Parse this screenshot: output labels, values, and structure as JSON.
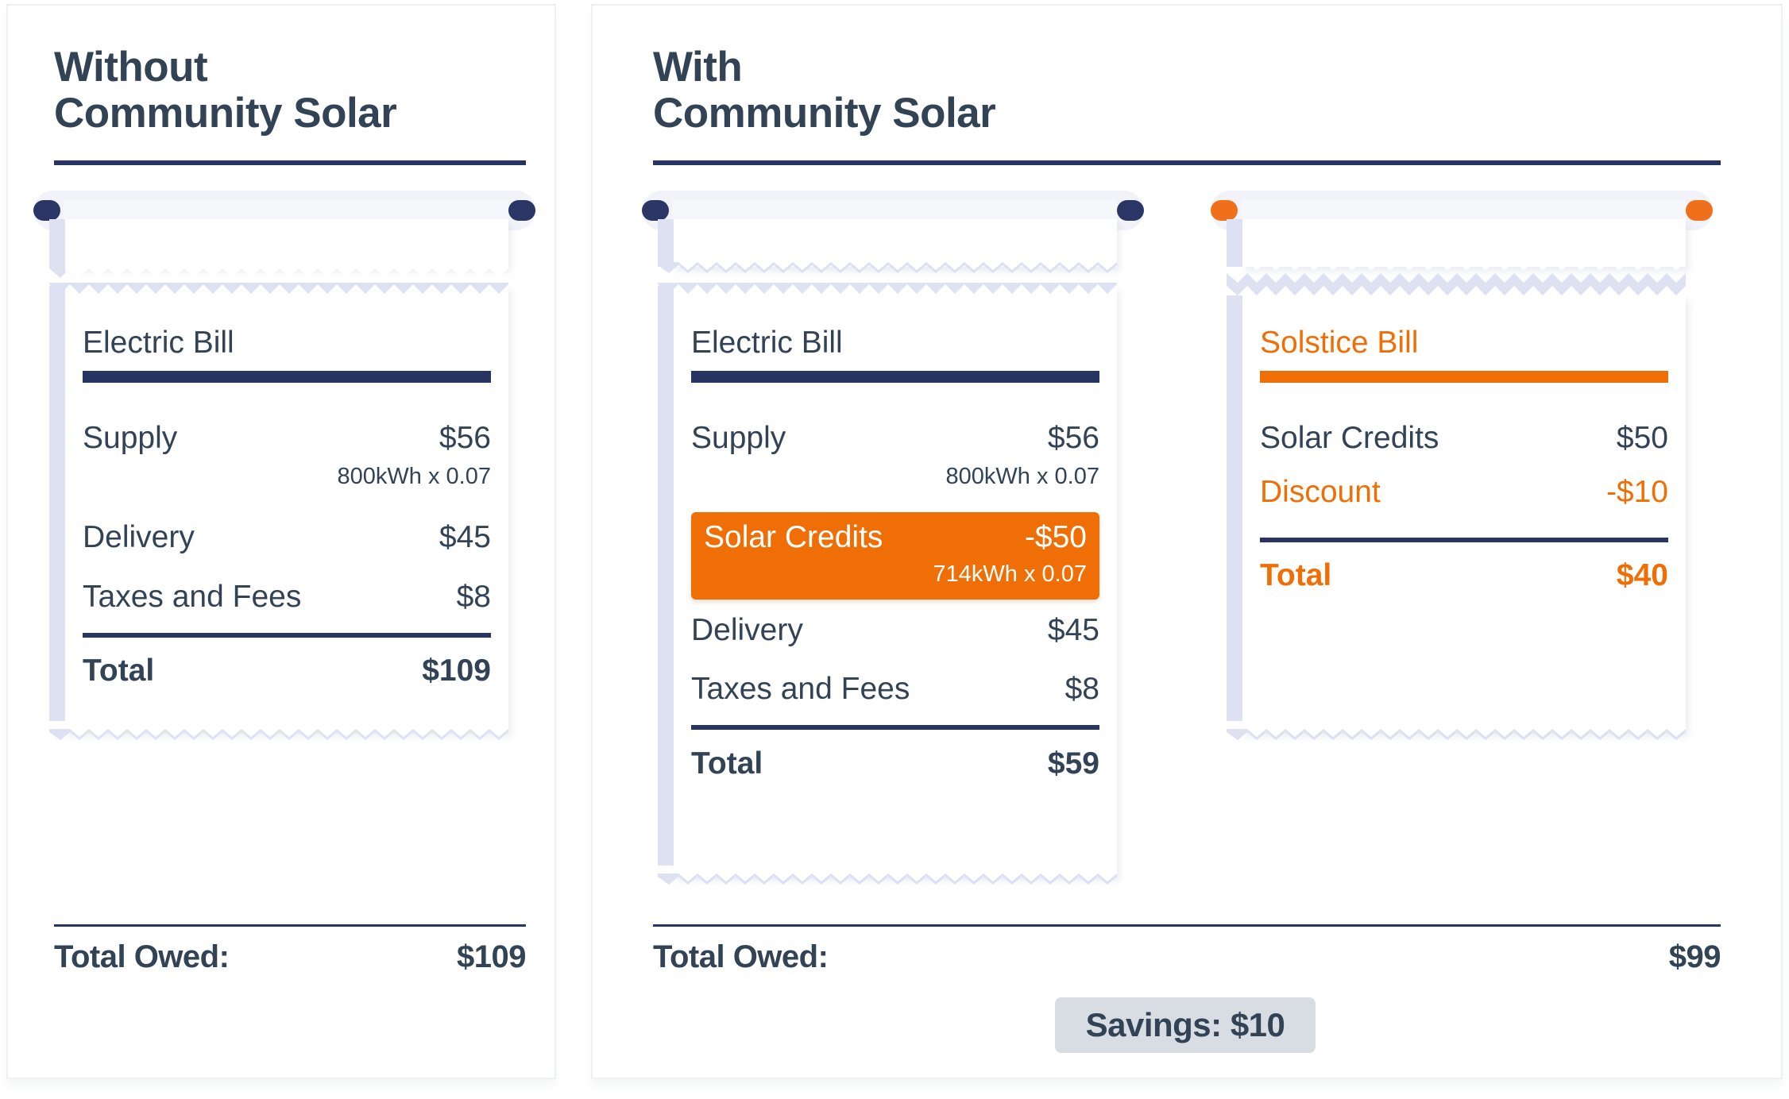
{
  "without": {
    "heading_line1": "Without",
    "heading_line2": "Community Solar",
    "bill": {
      "title": "Electric Bill",
      "supply_label": "Supply",
      "supply_amount": "$56",
      "supply_detail": "800kWh x 0.07",
      "delivery_label": "Delivery",
      "delivery_amount": "$45",
      "taxes_label": "Taxes and Fees",
      "taxes_amount": "$8",
      "total_label": "Total",
      "total_amount": "$109"
    },
    "total_owed_label": "Total Owed:",
    "total_owed_amount": "$109"
  },
  "with": {
    "heading_line1": "With",
    "heading_line2": "Community Solar",
    "electric_bill": {
      "title": "Electric Bill",
      "supply_label": "Supply",
      "supply_amount": "$56",
      "supply_detail": "800kWh x 0.07",
      "credits_label": "Solar Credits",
      "credits_amount": "-$50",
      "credits_detail": "714kWh x 0.07",
      "delivery_label": "Delivery",
      "delivery_amount": "$45",
      "taxes_label": "Taxes and Fees",
      "taxes_amount": "$8",
      "total_label": "Total",
      "total_amount": "$59"
    },
    "solstice_bill": {
      "title": "Solstice Bill",
      "credits_label": "Solar Credits",
      "credits_amount": "$50",
      "discount_label": "Discount",
      "discount_amount": "-$10",
      "total_label": "Total",
      "total_amount": "$40"
    },
    "total_owed_label": "Total Owed:",
    "total_owed_amount": "$99",
    "savings_label": "Savings: $10"
  },
  "colors": {
    "navy": "#283563",
    "text": "#324356",
    "orange": "#ef6f06",
    "receipt_edge": "#dde1f1",
    "savings_bg": "#d7dde3"
  }
}
